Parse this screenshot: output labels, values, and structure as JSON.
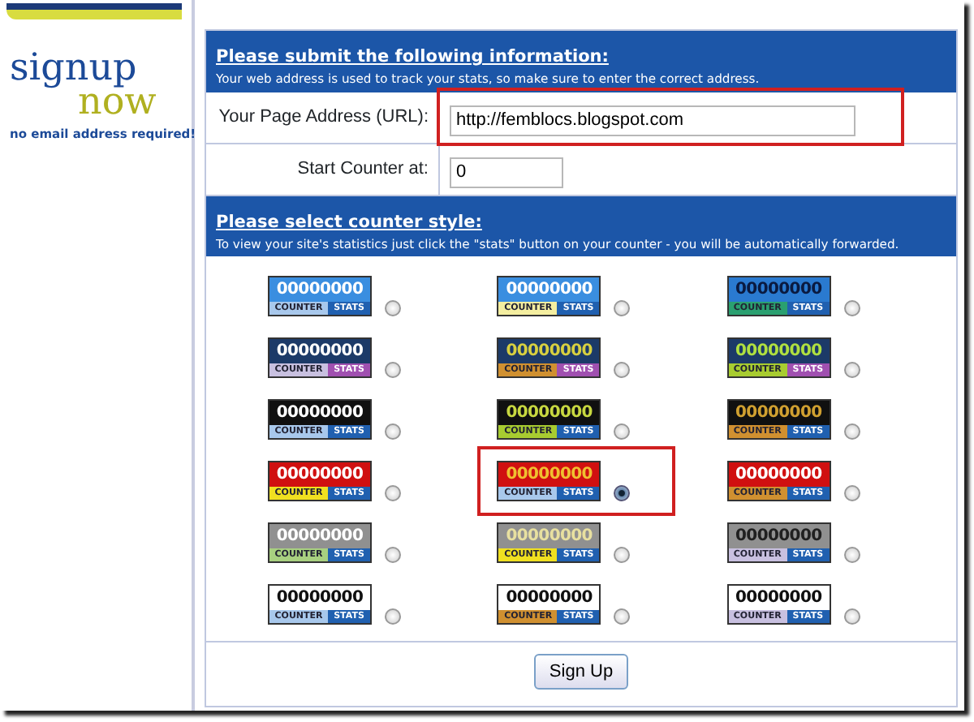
{
  "logo": {
    "word_top": "signup",
    "word_bottom": "now",
    "tagline": "no email address required!"
  },
  "info_header": {
    "title": "Please submit the following information:",
    "subtitle": "Your web address is used to track your stats, so make sure to enter the correct address."
  },
  "fields": [
    {
      "label": "Your Page Address (URL):",
      "value": "http://femblocs.blogspot.com",
      "highlighted": true,
      "kind": "wide"
    },
    {
      "label": "Start Counter at:",
      "value": "0",
      "highlighted": false,
      "kind": "short"
    }
  ],
  "style_header": {
    "title": "Please select counter style:",
    "subtitle": "To view your site's statistics just click the \"stats\" button on your counter - you will be automatically forwarded."
  },
  "counters": [
    {
      "color": "#3a8ee0",
      "digits": {
        "text": "00000000",
        "color": "#ffffff"
      },
      "counter_label": {
        "text": "COUNTER",
        "color": "#a8c8ec"
      },
      "stats_label": {
        "text": "STATS",
        "color": "#2060b0"
      },
      "selected": false,
      "highlighted": false
    },
    {
      "color": "#3a8ee0",
      "digits": {
        "text": "00000000",
        "color": "#ffffff"
      },
      "counter_label": {
        "text": "COUNTER",
        "color": "#f4eea0"
      },
      "stats_label": {
        "text": "STATS",
        "color": "#2060b0"
      },
      "selected": false,
      "highlighted": false
    },
    {
      "color": "#2a7ad0",
      "digits": {
        "text": "00000000",
        "color": "#0a1a40"
      },
      "counter_label": {
        "text": "COUNTER",
        "color": "#2aa070"
      },
      "stats_label": {
        "text": "STATS",
        "color": "#2060b0"
      },
      "selected": false,
      "highlighted": false
    },
    {
      "color": "#1c3a68",
      "digits": {
        "text": "00000000",
        "color": "#ffffff"
      },
      "counter_label": {
        "text": "COUNTER",
        "color": "#c8c0e0"
      },
      "stats_label": {
        "text": "STATS",
        "color": "#a050b0"
      },
      "selected": false,
      "highlighted": false
    },
    {
      "color": "#1c3a68",
      "digits": {
        "text": "00000000",
        "color": "#d8d040"
      },
      "counter_label": {
        "text": "COUNTER",
        "color": "#d09030"
      },
      "stats_label": {
        "text": "STATS",
        "color": "#a050b0"
      },
      "selected": false,
      "highlighted": false
    },
    {
      "color": "#1c3a68",
      "digits": {
        "text": "00000000",
        "color": "#b0e040"
      },
      "counter_label": {
        "text": "COUNTER",
        "color": "#a8cc30"
      },
      "stats_label": {
        "text": "STATS",
        "color": "#a050b0"
      },
      "selected": false,
      "highlighted": false
    },
    {
      "color": "#101010",
      "digits": {
        "text": "00000000",
        "color": "#ffffff"
      },
      "counter_label": {
        "text": "COUNTER",
        "color": "#a8c8ec"
      },
      "stats_label": {
        "text": "STATS",
        "color": "#2060b0"
      },
      "selected": false,
      "highlighted": false
    },
    {
      "color": "#101010",
      "digits": {
        "text": "00000000",
        "color": "#c8d840"
      },
      "counter_label": {
        "text": "COUNTER",
        "color": "#a8cc30"
      },
      "stats_label": {
        "text": "STATS",
        "color": "#2060b0"
      },
      "selected": false,
      "highlighted": false
    },
    {
      "color": "#101010",
      "digits": {
        "text": "00000000",
        "color": "#d0a030"
      },
      "counter_label": {
        "text": "COUNTER",
        "color": "#d09030"
      },
      "stats_label": {
        "text": "STATS",
        "color": "#2060b0"
      },
      "selected": false,
      "highlighted": false
    },
    {
      "color": "#d01010",
      "digits": {
        "text": "00000000",
        "color": "#ffffff"
      },
      "counter_label": {
        "text": "COUNTER",
        "color": "#f0e020"
      },
      "stats_label": {
        "text": "STATS",
        "color": "#2060b0"
      },
      "selected": false,
      "highlighted": false
    },
    {
      "color": "#d01010",
      "digits": {
        "text": "00000000",
        "color": "#f0c030"
      },
      "counter_label": {
        "text": "COUNTER",
        "color": "#a8c8ec"
      },
      "stats_label": {
        "text": "STATS",
        "color": "#2060b0"
      },
      "selected": true,
      "highlighted": true
    },
    {
      "color": "#d01010",
      "digits": {
        "text": "00000000",
        "color": "#ffffff"
      },
      "counter_label": {
        "text": "COUNTER",
        "color": "#d09030"
      },
      "stats_label": {
        "text": "STATS",
        "color": "#2060b0"
      },
      "selected": false,
      "highlighted": false
    },
    {
      "color": "#909090",
      "digits": {
        "text": "00000000",
        "color": "#ffffff"
      },
      "counter_label": {
        "text": "COUNTER",
        "color": "#a8d080"
      },
      "stats_label": {
        "text": "STATS",
        "color": "#2060b0"
      },
      "selected": false,
      "highlighted": false
    },
    {
      "color": "#909090",
      "digits": {
        "text": "00000000",
        "color": "#e8e0a0"
      },
      "counter_label": {
        "text": "COUNTER",
        "color": "#f0e020"
      },
      "stats_label": {
        "text": "STATS",
        "color": "#2060b0"
      },
      "selected": false,
      "highlighted": false
    },
    {
      "color": "#909090",
      "digits": {
        "text": "00000000",
        "color": "#202020"
      },
      "counter_label": {
        "text": "COUNTER",
        "color": "#c8c0e0"
      },
      "stats_label": {
        "text": "STATS",
        "color": "#2060b0"
      },
      "selected": false,
      "highlighted": false
    },
    {
      "color": "#ffffff",
      "digits": {
        "text": "00000000",
        "color": "#101010"
      },
      "counter_label": {
        "text": "COUNTER",
        "color": "#a8c8ec"
      },
      "stats_label": {
        "text": "STATS",
        "color": "#2060b0"
      },
      "selected": false,
      "highlighted": false
    },
    {
      "color": "#ffffff",
      "digits": {
        "text": "00000000",
        "color": "#101010"
      },
      "counter_label": {
        "text": "COUNTER",
        "color": "#d09030"
      },
      "stats_label": {
        "text": "STATS",
        "color": "#2060b0"
      },
      "selected": false,
      "highlighted": false
    },
    {
      "color": "#ffffff",
      "digits": {
        "text": "00000000",
        "color": "#101010"
      },
      "counter_label": {
        "text": "COUNTER",
        "color": "#c8c0e0"
      },
      "stats_label": {
        "text": "STATS",
        "color": "#2060b0"
      },
      "selected": false,
      "highlighted": false
    }
  ],
  "submit_button": "Sign Up"
}
